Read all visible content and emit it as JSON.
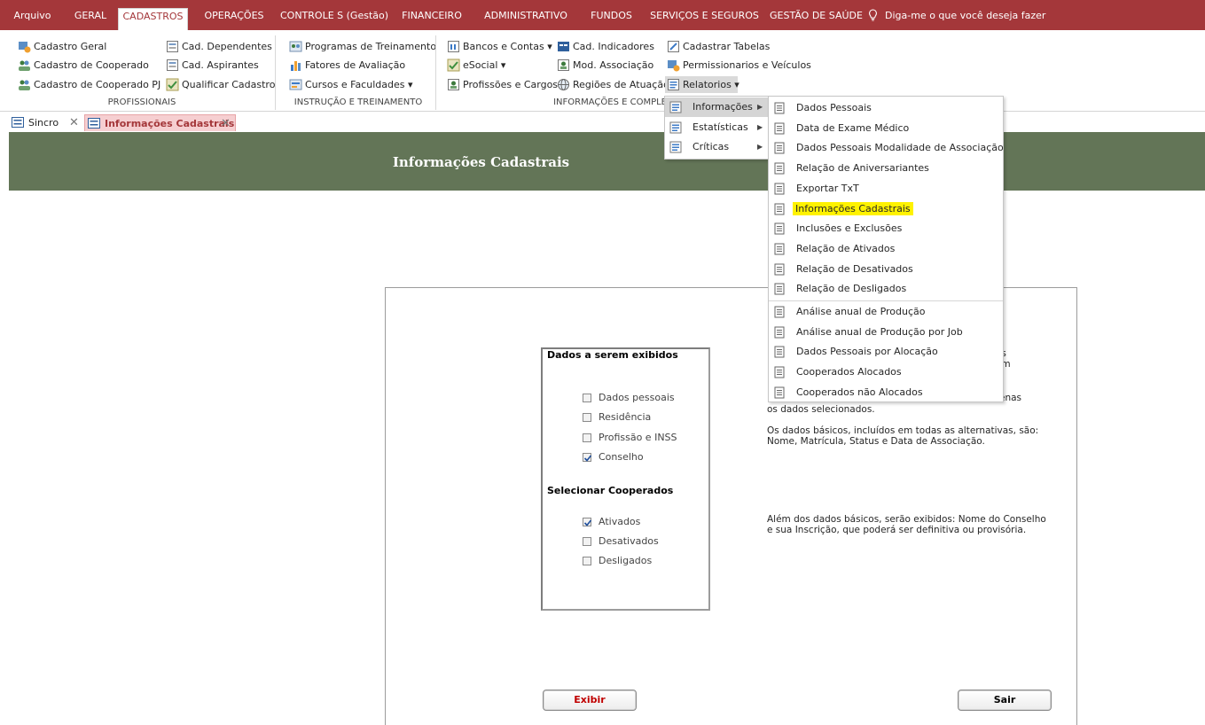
{
  "ribbon_tabs": [
    "Arquivo",
    "GERAL",
    "CADASTROS",
    "OPERAÇÕES",
    "CONTROLE S (Gestão)",
    "FINANCEIRO",
    "ADMINISTRATIVO",
    "FUNDOS",
    "SERVIÇOS E SEGUROS",
    "GESTÃO DE SAÚDE"
  ],
  "active_tab": "CADASTROS",
  "tell_me": "Diga-me o que você deseja fazer",
  "groups": {
    "profissionais": {
      "label": "PROFISSIONAIS",
      "items": [
        "Cadastro Geral",
        "Cadastro de Cooperado",
        "Cadastro de Cooperado PJ",
        "Cad. Dependentes",
        "Cad. Aspirantes",
        "Qualificar Cadastro"
      ]
    },
    "instrucao": {
      "label": "INSTRUÇÃO E TREINAMENTO",
      "items": [
        "Programas de Treinamento",
        "Fatores de Avaliação",
        "Cursos e Faculdades ▾"
      ]
    },
    "informacoes": {
      "label": "INFORMAÇÕES E  COMPLE",
      "items": [
        "Bancos e Contas ▾",
        "eSocial ▾",
        "Profissões e Cargos",
        "Cad. Indicadores",
        "Mod. Associação",
        "Regiões de Atuação",
        "Cadastrar Tabelas",
        "Permissionarios e Veículos",
        "Relatorios ▾"
      ]
    }
  },
  "doc_tabs": [
    "Sincro",
    "Informações Cadastrais"
  ],
  "form": {
    "title": "Informações Cadastrais",
    "group1_title": "Dados a serem exibidos",
    "group1_options": [
      {
        "label": "Dados pessoais",
        "checked": false
      },
      {
        "label": "Residência",
        "checked": false
      },
      {
        "label": "Profissão e INSS",
        "checked": false
      },
      {
        "label": "Conselho",
        "checked": true
      }
    ],
    "group2_title": "Selecionar Cooperados",
    "group2_options": [
      {
        "label": "Ativados",
        "checked": true
      },
      {
        "label": "Desativados",
        "checked": false
      },
      {
        "label": "Desligados",
        "checked": false
      }
    ],
    "note_fragments": [
      "os",
      "om",
      "enas"
    ],
    "note_line1": "os dados selecionados.",
    "note_line2": "Os dados básicos, incluídos em todas as alternativas, são:",
    "note_line3": "Nome, Matrícula, Status e Data de Associação.",
    "note_line4": "Além dos dados básicos, serão exibidos: Nome do Conselho",
    "note_line5": "e sua Inscrição, que poderá ser definitiva ou provisória.",
    "btn_exibir": "Exibir",
    "btn_sair": "Sair"
  },
  "menu_level1": [
    {
      "label": "Informações",
      "selected": true
    },
    {
      "label": "Estatísticas",
      "selected": false
    },
    {
      "label": "Críticas",
      "selected": false
    }
  ],
  "menu_level2": [
    "Dados Pessoais",
    "Data de Exame Médico",
    "Dados Pessoais Modalidade de Associação",
    "Relação de Aniversariantes",
    "Exportar TxT",
    "Informações Cadastrais",
    "Inclusões e Exclusões",
    "Relação de Ativados",
    "Relação de Desativados",
    "Relação de Desligados",
    "Análise anual de Produção",
    "Análise anual de Produção por Job",
    "Dados Pessoais por Alocação",
    "Cooperados Alocados",
    "Cooperados não Alocados"
  ],
  "highlighted_item": "Informações Cadastrais",
  "colors": {
    "ribbon": "#a4373a",
    "form_header": "#637557",
    "exibir_text": "#c00000",
    "highlight": "#fff200"
  }
}
